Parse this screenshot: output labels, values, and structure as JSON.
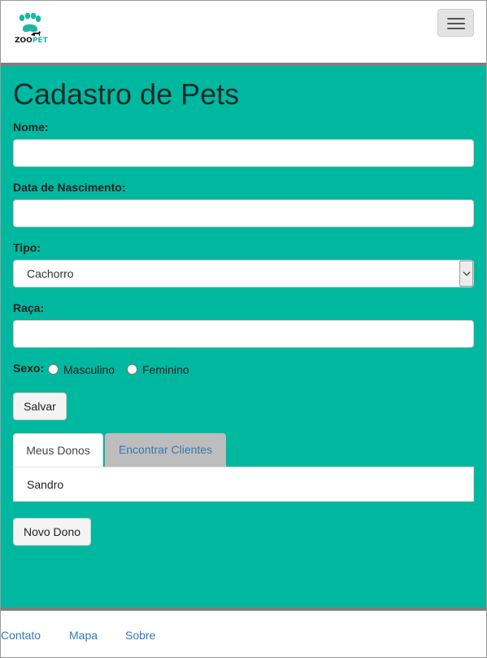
{
  "header": {
    "logo_text_zoo": "ZOO",
    "logo_text_pet": "PET",
    "menu_button_label": "Toggle navigation"
  },
  "colors": {
    "main_background": "#00b8a0",
    "link": "#337ab7",
    "logo_accent": "#1fb5a3"
  },
  "form": {
    "title": "Cadastro de Pets",
    "nome": {
      "label": "Nome:",
      "value": ""
    },
    "data_nascimento": {
      "label": "Data de Nascimento:",
      "value": ""
    },
    "tipo": {
      "label": "Tipo:",
      "selected": "Cachorro"
    },
    "raca": {
      "label": "Raça:",
      "value": ""
    },
    "sexo": {
      "label": "Sexo:",
      "options": [
        "Masculino",
        "Feminino"
      ]
    },
    "save_label": "Salvar"
  },
  "tabs": {
    "items": [
      {
        "label": "Meus Donos",
        "active": true
      },
      {
        "label": "Encontrar Clientes",
        "active": false
      }
    ],
    "panel_items": [
      "Sandro"
    ]
  },
  "new_owner_label": "Novo Dono",
  "footer": {
    "links": [
      "Contato",
      "Mapa",
      "Sobre"
    ]
  },
  "icons": {
    "logo": "paw-icon",
    "menu": "hamburger-icon",
    "select_arrow": "chevron-down-icon"
  }
}
